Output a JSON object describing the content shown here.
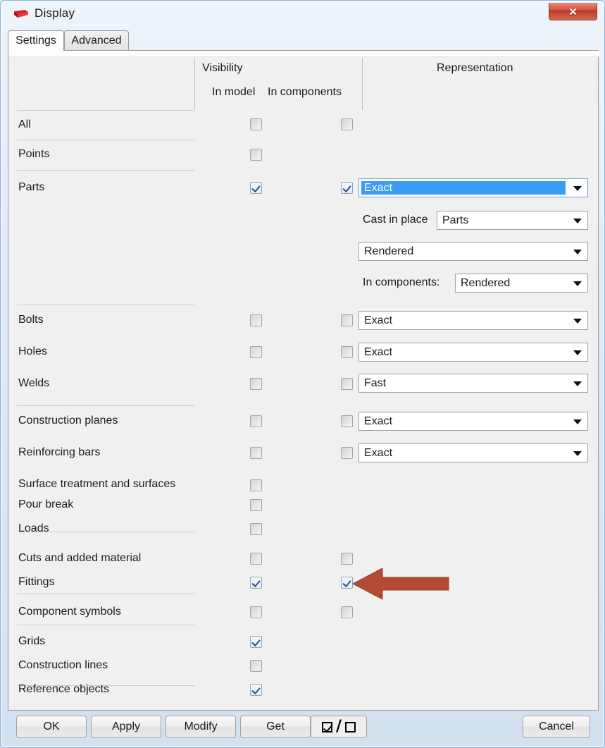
{
  "window": {
    "title": "Display",
    "app_icon": "tekla-flag-icon",
    "close_label": "✕",
    "close_icon": "close-icon"
  },
  "tabs": [
    {
      "label": "Settings",
      "active": true
    },
    {
      "label": "Advanced",
      "active": false
    }
  ],
  "columns": {
    "visibility": "Visibility",
    "in_model": "In model",
    "in_components": "In components",
    "representation": "Representation"
  },
  "rows": [
    {
      "label": "All",
      "in_model": "unchecked",
      "in_components": "unchecked",
      "representation": null
    },
    {
      "label": "Points",
      "in_model": "unchecked",
      "in_components": null,
      "representation": null
    },
    {
      "label": "Parts",
      "in_model": "checked",
      "in_components": "checked",
      "representation": "Exact",
      "selected": true
    },
    {
      "label": "Bolts",
      "in_model": "unchecked",
      "in_components": "unchecked",
      "representation": "Exact"
    },
    {
      "label": "Holes",
      "in_model": "unchecked",
      "in_components": "unchecked",
      "representation": "Exact"
    },
    {
      "label": "Welds",
      "in_model": "unchecked",
      "in_components": "unchecked",
      "representation": "Fast"
    },
    {
      "label": "Construction planes",
      "in_model": "unchecked",
      "in_components": "unchecked",
      "representation": "Exact"
    },
    {
      "label": "Reinforcing bars",
      "in_model": "unchecked",
      "in_components": "unchecked",
      "representation": "Exact"
    },
    {
      "label": "Surface treatment and surfaces",
      "in_model": "unchecked",
      "in_components": null,
      "representation": null
    },
    {
      "label": "Pour break",
      "in_model": "unchecked",
      "in_components": null,
      "representation": null
    },
    {
      "label": "Loads",
      "in_model": "unchecked",
      "in_components": null,
      "representation": null
    },
    {
      "label": "Cuts and added material",
      "in_model": "unchecked",
      "in_components": "unchecked",
      "representation": null
    },
    {
      "label": "Fittings",
      "in_model": "checked",
      "in_components": "checked",
      "representation": null
    },
    {
      "label": "Component symbols",
      "in_model": "unchecked",
      "in_components": "unchecked",
      "representation": null
    },
    {
      "label": "Grids",
      "in_model": "checked",
      "in_components": null,
      "representation": null
    },
    {
      "label": "Construction lines",
      "in_model": "unchecked",
      "in_components": null,
      "representation": null
    },
    {
      "label": "Reference objects",
      "in_model": "checked",
      "in_components": null,
      "representation": null
    }
  ],
  "parts_extra": {
    "cast_in_place_label": "Cast in place",
    "cast_in_place_value": "Parts",
    "rendered_value": "Rendered",
    "in_components_label": "In components:",
    "in_components_value": "Rendered"
  },
  "buttons": {
    "ok": "OK",
    "apply": "Apply",
    "modify": "Modify",
    "get": "Get",
    "toggle": "☑ / ☐",
    "cancel": "Cancel"
  },
  "annotation": {
    "type": "arrow",
    "direction": "left",
    "color": "#b34a33",
    "points_at": "Fittings in-components checkbox"
  },
  "colors": {
    "selection_blue": "#3a9bf5",
    "dialog_bg": "#f0f0f0",
    "titlebar_gradient_top": "#eef4fb",
    "close_red": "#bb3a28",
    "annotation_red": "#b34a33"
  }
}
